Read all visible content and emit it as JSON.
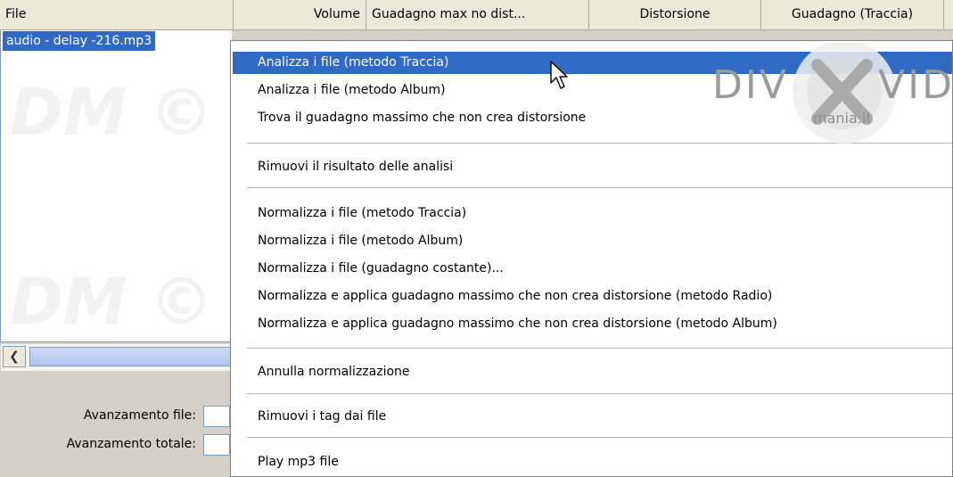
{
  "columns": [
    "File",
    "Volume",
    "Guadagno max no dist...",
    "Distorsione",
    "Guadagno (Traccia)"
  ],
  "file_list": {
    "selected_file": "audio - delay -216.mp3"
  },
  "watermark": "DM ©",
  "progress": {
    "file_label": "Avanzamento file:",
    "total_label": "Avanzamento totale:"
  },
  "context_menu": {
    "group1": [
      "Analizza i file (metodo Traccia)",
      "Analizza i file (metodo Album)",
      "Trova il guadagno massimo che non crea distorsione"
    ],
    "group2": [
      "Rimuovi il risultato delle analisi"
    ],
    "group3": [
      "Normalizza i file (metodo Traccia)",
      "Normalizza i file (metodo Album)",
      "Normalizza i file (guadagno costante)...",
      "Normalizza e applica guadagno massimo che non crea distorsione (metodo Radio)",
      "Normalizza e applica guadagno massimo che non crea distorsione (metodo Album)"
    ],
    "group4": [
      "Annulla normalizzazione"
    ],
    "group5": [
      "Rimuovi i tag dai file"
    ],
    "group6": [
      "Play mp3 file"
    ]
  },
  "logo": {
    "brand": "DIVXVID",
    "sub": "mania.it"
  },
  "colors": {
    "selection": "#316ac5",
    "header": "#ece9d8",
    "frame": "#d4d0c8"
  }
}
